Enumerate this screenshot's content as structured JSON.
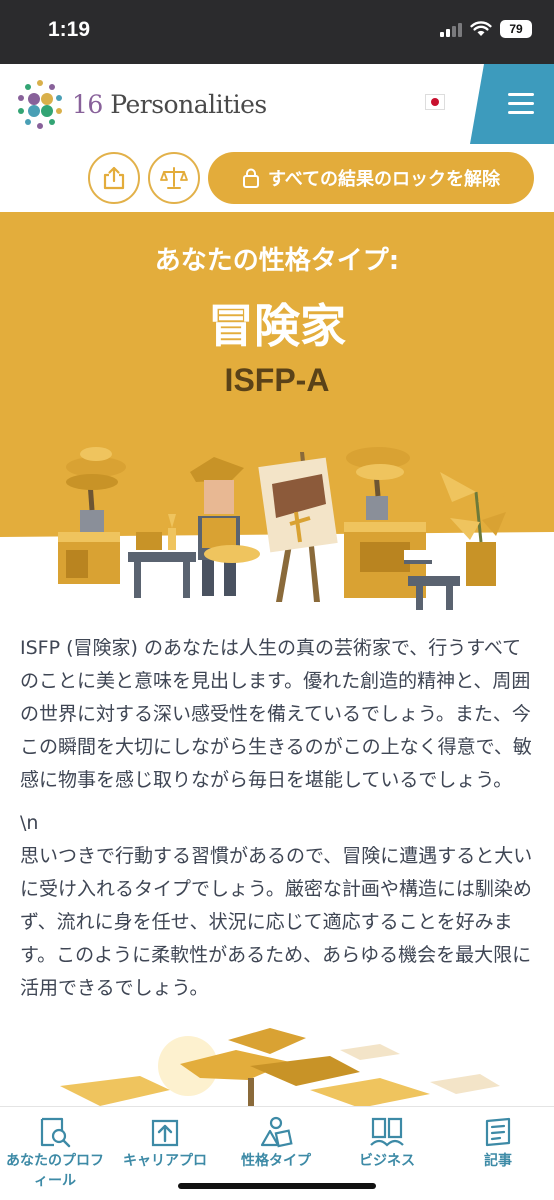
{
  "status_bar": {
    "time": "1:19",
    "battery": "79"
  },
  "header": {
    "logo_prefix": "16",
    "logo_name": "Personalities",
    "language_flag": "japan-flag-icon",
    "menu_icon": "hamburger-icon"
  },
  "actions": {
    "share_icon": "share-icon",
    "compare_icon": "balance-scale-icon",
    "unlock_label": "すべての結果のロックを解除"
  },
  "hero": {
    "subtitle": "あなたの性格タイプ:",
    "type_name": "冒険家",
    "type_code": "ISFP-A",
    "background_color": "#e3ad3c"
  },
  "content": {
    "paragraph1": "ISFP (冒険家) のあなたは人生の真の芸術家で、行うすべてのことに美と意味を見出します。優れた創造的精神と、周囲の世界に対する深い感受性を備えているでしょう。また、今この瞬間を大切にしながら生きるのがこの上なく得意で、敏感に物事を感じ取りながら毎日を堪能しているでしょう。",
    "separator": "\\n",
    "paragraph2": "思いつきで行動する習慣があるので、冒険に遭遇すると大いに受け入れるタイプでしょう。厳密な計画や構造には馴染めず、流れに身を任せ、状況に応じて適応することを好みます。このように柔軟性があるため、あらゆる機会を最大限に活用できるでしょう。"
  },
  "tabbar": {
    "items": [
      {
        "label": "あなたのプロフィール",
        "icon": "profile-search-icon"
      },
      {
        "label": "キャリアプロ",
        "icon": "career-arrow-icon"
      },
      {
        "label": "性格タイプ",
        "icon": "personality-types-icon"
      },
      {
        "label": "ビジネス",
        "icon": "business-people-icon"
      },
      {
        "label": "記事",
        "icon": "articles-icon"
      }
    ]
  },
  "colors": {
    "accent": "#e3ac3b",
    "teal": "#3d8aa6",
    "text": "#3f4654"
  }
}
